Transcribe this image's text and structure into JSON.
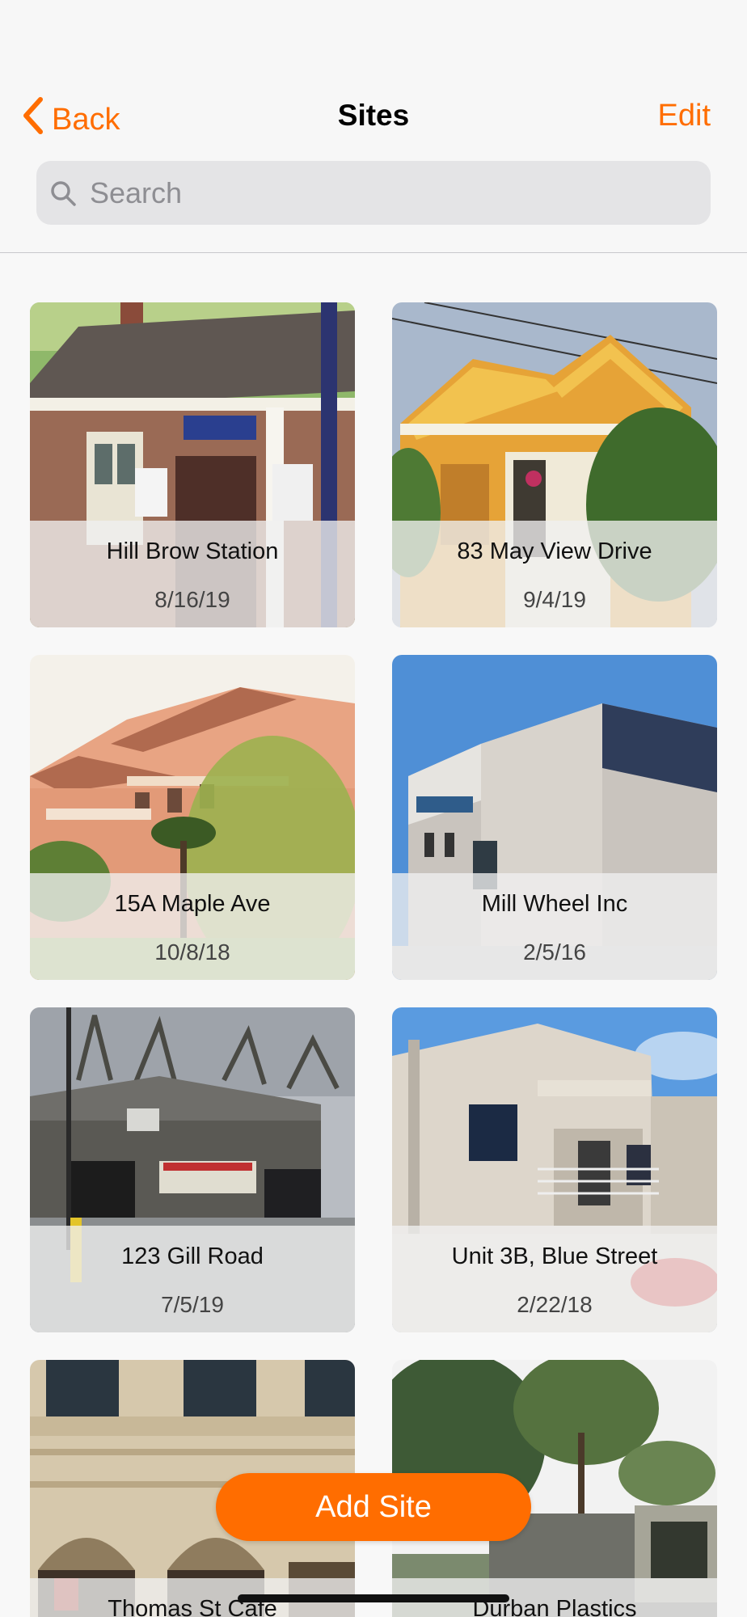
{
  "nav": {
    "back_label": "Back",
    "title": "Sites",
    "edit_label": "Edit"
  },
  "search": {
    "placeholder": "Search",
    "value": ""
  },
  "sites": [
    {
      "name": "Hill Brow Station",
      "date": "8/16/19",
      "photo": "brick-station-icon"
    },
    {
      "name": "83 May View Drive",
      "date": "9/4/19",
      "photo": "yellow-house-icon"
    },
    {
      "name": "15A Maple Ave",
      "date": "10/8/18",
      "photo": "apartment-icon"
    },
    {
      "name": "Mill Wheel Inc",
      "date": "2/5/16",
      "photo": "office-building-icon"
    },
    {
      "name": "123 Gill Road",
      "date": "7/5/19",
      "photo": "warehouse-icon"
    },
    {
      "name": "Unit 3B, Blue Street",
      "date": "2/22/18",
      "photo": "townhouse-icon"
    },
    {
      "name": "Thomas St Cafe",
      "date": "",
      "photo": "stone-building-icon"
    },
    {
      "name": "Durban Plastics",
      "date": "",
      "photo": "factory-icon"
    }
  ],
  "add_site_label": "Add Site",
  "colors": {
    "accent": "#ff6d00",
    "background": "#f8f8f8",
    "search_bg": "#e4e4e6"
  }
}
